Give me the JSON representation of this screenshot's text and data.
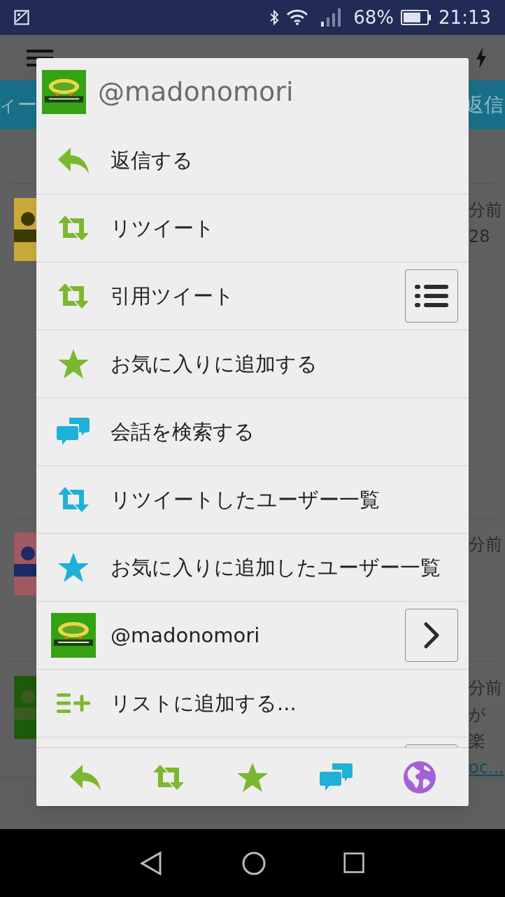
{
  "status_bar": {
    "battery": "68%",
    "time": "21:13"
  },
  "background": {
    "tab_bar": {
      "left": "ィー",
      "right": "返信"
    },
    "rows": [
      {
        "texts": [
          "分前",
          "28"
        ]
      },
      {
        "texts": [
          "分前"
        ]
      },
      {
        "texts": [
          "分前",
          "が",
          "楽"
        ],
        "link": "oc..."
      }
    ]
  },
  "dialog": {
    "title": "@madonomori",
    "items": [
      {
        "kind": "reply",
        "label": "返信する",
        "color": "#7cb82f"
      },
      {
        "kind": "retweet",
        "label": "リツイート",
        "color": "#7cb82f"
      },
      {
        "kind": "retweet",
        "label": "引用ツイート",
        "color": "#7cb82f",
        "accessory": {
          "kind": "menu"
        }
      },
      {
        "kind": "star",
        "label": "お気に入りに追加する",
        "color": "#7cb82f"
      },
      {
        "kind": "chat",
        "label": "会話を検索する",
        "color": "#1fb0d8"
      },
      {
        "kind": "retweet",
        "label": "リツイートしたユーザー一覧",
        "color": "#1fb0d8"
      },
      {
        "kind": "star",
        "label": "お気に入りに追加したユーザー一覧",
        "color": "#1fb0d8"
      },
      {
        "kind": "user",
        "label": "@madonomori",
        "accessory": {
          "kind": "chevron"
        }
      },
      {
        "kind": "list-add",
        "label": "リストに追加する...",
        "color": "#7cb82f"
      }
    ],
    "toolbar": [
      {
        "kind": "reply",
        "color": "#7cb82f"
      },
      {
        "kind": "retweet",
        "color": "#7cb82f"
      },
      {
        "kind": "star",
        "color": "#7cb82f"
      },
      {
        "kind": "chat",
        "color": "#1fb0d8"
      },
      {
        "kind": "globe",
        "color": "#a65fd6"
      }
    ]
  }
}
